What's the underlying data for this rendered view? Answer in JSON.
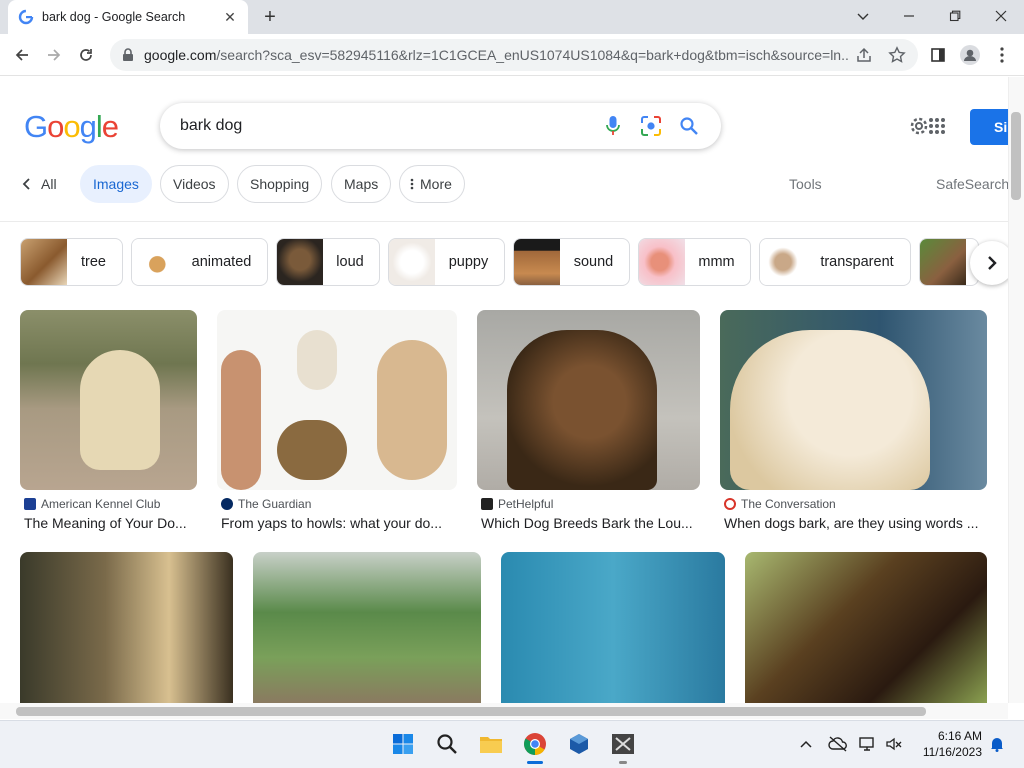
{
  "browser": {
    "tab_title": "bark dog - Google Search",
    "url_host": "google.com",
    "url_rest": "/search?sca_esv=582945116&rlz=1C1GCEA_enUS1074US1084&q=bark+dog&tbm=isch&source=ln..."
  },
  "search": {
    "logo": "Google",
    "query": "bark dog",
    "signin_label": "Si"
  },
  "filters": {
    "all": "All",
    "images": "Images",
    "videos": "Videos",
    "shopping": "Shopping",
    "maps": "Maps",
    "more": "More",
    "tools": "Tools",
    "safesearch": "SafeSearch"
  },
  "refinements": [
    "tree",
    "animated",
    "loud",
    "puppy",
    "sound",
    "mmm",
    "transparent"
  ],
  "results": [
    {
      "source": "American Kennel Club",
      "caption": "The Meaning of Your Do..."
    },
    {
      "source": "The Guardian",
      "caption": "From yaps to howls: what your do..."
    },
    {
      "source": "PetHelpful",
      "caption": "Which Dog Breeds Bark the Lou..."
    },
    {
      "source": "The Conversation",
      "caption": "When dogs bark, are they using words ..."
    }
  ],
  "taskbar": {
    "time": "6:16 AM",
    "date": "11/16/2023"
  },
  "colors": {
    "accent": "#1a73e8",
    "google_blue": "#4285f4",
    "google_red": "#ea4335",
    "google_yellow": "#fbbc05",
    "google_green": "#34a853"
  }
}
